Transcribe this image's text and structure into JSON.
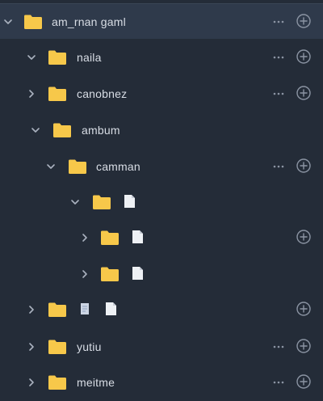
{
  "colors": {
    "background": "#242c38",
    "selected_row": "#2f3a4b",
    "folder": "#f7c84a",
    "file": "#eef1f5",
    "text": "#d8dde5",
    "icon_muted": "#8b94a3"
  },
  "tree": {
    "rows": [
      {
        "label": "am_rnan gaml",
        "expanded": true,
        "icon": "folder-icon"
      },
      {
        "label": "naila",
        "expanded": true,
        "icon": "folder-icon"
      },
      {
        "label": "canobnez",
        "expanded": false,
        "icon": "folder-icon"
      },
      {
        "label": "ambum",
        "expanded": true,
        "icon": "folder-icon"
      },
      {
        "label": "camman",
        "expanded": true,
        "icon": "folder-icon"
      },
      {
        "label": "",
        "expanded": true,
        "icon": "folder-icon"
      },
      {
        "label": "",
        "expanded": false,
        "icon": "folder-icon"
      },
      {
        "label": "",
        "expanded": false,
        "icon": "folder-icon"
      },
      {
        "label": "",
        "expanded": false,
        "icon": "folder-icon"
      },
      {
        "label": "yutiu",
        "expanded": false,
        "icon": "folder-icon"
      },
      {
        "label": "meitme",
        "expanded": false,
        "icon": "folder-icon"
      }
    ]
  }
}
